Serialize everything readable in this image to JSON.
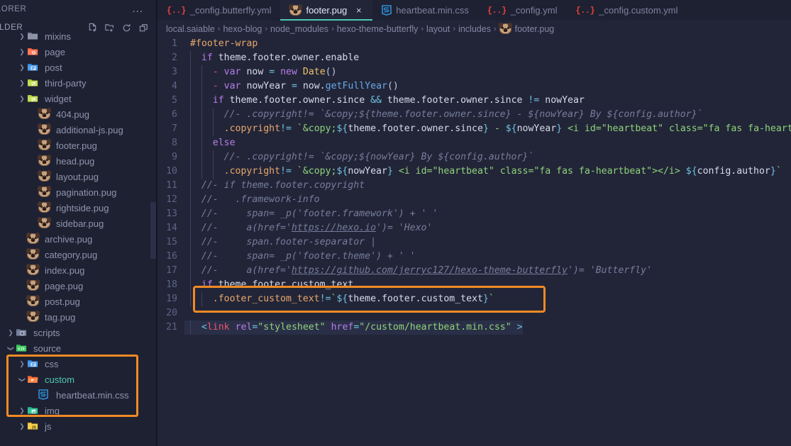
{
  "sidebar": {
    "explorer_label": "EXPLORER",
    "folder_label": "FOLDER",
    "more_actions": "...",
    "toolbar": [
      {
        "name": "new-file-icon",
        "label": "New File"
      },
      {
        "name": "new-folder-icon",
        "label": "New Folder"
      },
      {
        "name": "refresh-icon",
        "label": "Refresh Explorer"
      },
      {
        "name": "collapse-all-icon",
        "label": "Collapse Folders in Explorer"
      }
    ],
    "tree": [
      {
        "label": "mixins",
        "indent": 1,
        "chevron": "collapsed",
        "icon": "folder-grey",
        "color": "#8f95ad"
      },
      {
        "label": "page",
        "indent": 1,
        "chevron": "collapsed",
        "icon": "folder-orange",
        "color": "#8f95ad"
      },
      {
        "label": "post",
        "indent": 1,
        "chevron": "collapsed",
        "icon": "folder-blue",
        "color": "#8f95ad"
      },
      {
        "label": "third-party",
        "indent": 1,
        "chevron": "collapsed",
        "icon": "folder-lime",
        "color": "#8f95ad"
      },
      {
        "label": "widget",
        "indent": 1,
        "chevron": "collapsed",
        "icon": "folder-lime",
        "color": "#8f95ad"
      },
      {
        "label": "404.pug",
        "indent": 2,
        "chevron": "none",
        "icon": "pug-file",
        "color": "#8f95ad"
      },
      {
        "label": "additional-js.pug",
        "indent": 2,
        "chevron": "none",
        "icon": "pug-file",
        "color": "#8f95ad"
      },
      {
        "label": "footer.pug",
        "indent": 2,
        "chevron": "none",
        "icon": "pug-file",
        "color": "#8f95ad"
      },
      {
        "label": "head.pug",
        "indent": 2,
        "chevron": "none",
        "icon": "pug-file",
        "color": "#8f95ad"
      },
      {
        "label": "layout.pug",
        "indent": 2,
        "chevron": "none",
        "icon": "pug-file",
        "color": "#8f95ad"
      },
      {
        "label": "pagination.pug",
        "indent": 2,
        "chevron": "none",
        "icon": "pug-file",
        "color": "#8f95ad"
      },
      {
        "label": "rightside.pug",
        "indent": 2,
        "chevron": "none",
        "icon": "pug-file",
        "color": "#8f95ad"
      },
      {
        "label": "sidebar.pug",
        "indent": 2,
        "chevron": "none",
        "icon": "pug-file",
        "color": "#8f95ad"
      },
      {
        "label": "archive.pug",
        "indent": 1,
        "chevron": "none",
        "icon": "pug-file",
        "color": "#8f95ad"
      },
      {
        "label": "category.pug",
        "indent": 1,
        "chevron": "none",
        "icon": "pug-file",
        "color": "#8f95ad"
      },
      {
        "label": "index.pug",
        "indent": 1,
        "chevron": "none",
        "icon": "pug-file",
        "color": "#8f95ad"
      },
      {
        "label": "page.pug",
        "indent": 1,
        "chevron": "none",
        "icon": "pug-file",
        "color": "#8f95ad"
      },
      {
        "label": "post.pug",
        "indent": 1,
        "chevron": "none",
        "icon": "pug-file",
        "color": "#8f95ad"
      },
      {
        "label": "tag.pug",
        "indent": 1,
        "chevron": "none",
        "icon": "pug-file",
        "color": "#8f95ad"
      },
      {
        "label": "scripts",
        "indent": 0,
        "chevron": "collapsed",
        "icon": "folder-script",
        "color": "#8f95ad"
      },
      {
        "label": "source",
        "indent": 0,
        "chevron": "expanded",
        "icon": "folder-source",
        "color": "#8f95ad"
      },
      {
        "label": "css",
        "indent": 1,
        "chevron": "collapsed",
        "icon": "folder-blue",
        "color": "#8f95ad"
      },
      {
        "label": "custom",
        "indent": 1,
        "chevron": "expanded",
        "icon": "folder-open-orange",
        "color": "#4ec9b0"
      },
      {
        "label": "heartbeat.min.css",
        "indent": 2,
        "chevron": "none",
        "icon": "css-file",
        "color": "#8f95ad"
      },
      {
        "label": "img",
        "indent": 1,
        "chevron": "collapsed",
        "icon": "folder-teal",
        "color": "#8f95ad"
      },
      {
        "label": "js",
        "indent": 1,
        "chevron": "collapsed",
        "icon": "folder-yellow",
        "color": "#8f95ad"
      }
    ],
    "highlight_color": "#f08a24"
  },
  "tabs": [
    {
      "label": "_config.butterfly.yml",
      "icon": "yml-icon",
      "active": false,
      "closable": false
    },
    {
      "label": "footer.pug",
      "icon": "pug-icon",
      "active": true,
      "closable": true,
      "close_label": "×"
    },
    {
      "label": "heartbeat.min.css",
      "icon": "css-icon",
      "active": false,
      "closable": false
    },
    {
      "label": "_config.yml",
      "icon": "yml-icon",
      "active": false,
      "closable": false
    },
    {
      "label": "_config.custom.yml",
      "icon": "yml-icon",
      "active": false,
      "closable": false
    }
  ],
  "breadcrumb": {
    "separator": "›",
    "items": [
      {
        "label": "local.saiable",
        "icon": null
      },
      {
        "label": "hexo-blog",
        "icon": null
      },
      {
        "label": "node_modules",
        "icon": null
      },
      {
        "label": "hexo-theme-butterfly",
        "icon": null
      },
      {
        "label": "layout",
        "icon": null
      },
      {
        "label": "includes",
        "icon": null
      },
      {
        "label": "footer.pug",
        "icon": "pug-icon"
      }
    ]
  },
  "editor": {
    "active_file": "footer.pug",
    "highlight_line": 21,
    "highlight_color": "#f08a24",
    "lines": [
      {
        "n": 1,
        "tokens": [
          {
            "t": "#footer-wrap",
            "c": "t-sel"
          }
        ],
        "indent": 0
      },
      {
        "n": 2,
        "tokens": [
          {
            "t": "  ",
            "c": "t-plain"
          },
          {
            "t": "if",
            "c": "t-kw"
          },
          {
            "t": " theme.footer.owner.enable",
            "c": "t-plain"
          }
        ],
        "indent": 1
      },
      {
        "n": 3,
        "tokens": [
          {
            "t": "    ",
            "c": "t-plain"
          },
          {
            "t": "-",
            "c": "t-dash"
          },
          {
            "t": " ",
            "c": "t-plain"
          },
          {
            "t": "var",
            "c": "t-kw"
          },
          {
            "t": " now ",
            "c": "t-plain"
          },
          {
            "t": "=",
            "c": "t-op"
          },
          {
            "t": " ",
            "c": "t-plain"
          },
          {
            "t": "new",
            "c": "t-kw"
          },
          {
            "t": " ",
            "c": "t-plain"
          },
          {
            "t": "Date",
            "c": "t-cls"
          },
          {
            "t": "()",
            "c": "t-punc"
          }
        ],
        "indent": 2
      },
      {
        "n": 4,
        "tokens": [
          {
            "t": "    ",
            "c": "t-plain"
          },
          {
            "t": "-",
            "c": "t-dash"
          },
          {
            "t": " ",
            "c": "t-plain"
          },
          {
            "t": "var",
            "c": "t-kw"
          },
          {
            "t": " nowYear ",
            "c": "t-plain"
          },
          {
            "t": "=",
            "c": "t-op"
          },
          {
            "t": " now.",
            "c": "t-plain"
          },
          {
            "t": "getFullYear",
            "c": "t-fn"
          },
          {
            "t": "()",
            "c": "t-punc"
          }
        ],
        "indent": 2
      },
      {
        "n": 5,
        "tokens": [
          {
            "t": "    ",
            "c": "t-plain"
          },
          {
            "t": "if",
            "c": "t-kw"
          },
          {
            "t": " theme.footer.owner.since ",
            "c": "t-plain"
          },
          {
            "t": "&&",
            "c": "t-op"
          },
          {
            "t": " theme.footer.owner.since ",
            "c": "t-plain"
          },
          {
            "t": "!=",
            "c": "t-op"
          },
          {
            "t": " nowYear",
            "c": "t-plain"
          }
        ],
        "indent": 2
      },
      {
        "n": 6,
        "tokens": [
          {
            "t": "      //- .copyright!= `&copy;${theme.footer.owner.since} - ${nowYear} By ${config.author}`",
            "c": "t-cmt"
          }
        ],
        "indent": 3
      },
      {
        "n": 7,
        "tokens": [
          {
            "t": "      ",
            "c": "t-plain"
          },
          {
            "t": ".copyright",
            "c": "t-sel"
          },
          {
            "t": "!=",
            "c": "t-op"
          },
          {
            "t": " ",
            "c": "t-plain"
          },
          {
            "t": "`",
            "c": "t-str"
          },
          {
            "t": "&copy;",
            "c": "t-str"
          },
          {
            "t": "${",
            "c": "t-intp"
          },
          {
            "t": "theme.footer.owner.since",
            "c": "t-plain"
          },
          {
            "t": "}",
            "c": "t-intp"
          },
          {
            "t": " - ",
            "c": "t-str"
          },
          {
            "t": "${",
            "c": "t-intp"
          },
          {
            "t": "nowYear",
            "c": "t-plain"
          },
          {
            "t": "}",
            "c": "t-intp"
          },
          {
            "t": " <i id=\"heartbeat\" class=\"fa fas fa-heartbeat\">",
            "c": "t-str"
          }
        ],
        "indent": 3
      },
      {
        "n": 8,
        "tokens": [
          {
            "t": "    ",
            "c": "t-plain"
          },
          {
            "t": "else",
            "c": "t-kw"
          }
        ],
        "indent": 2
      },
      {
        "n": 9,
        "tokens": [
          {
            "t": "      //- .copyright!= `&copy;${nowYear} By ${config.author}`",
            "c": "t-cmt"
          }
        ],
        "indent": 3
      },
      {
        "n": 10,
        "tokens": [
          {
            "t": "      ",
            "c": "t-plain"
          },
          {
            "t": ".copyright",
            "c": "t-sel"
          },
          {
            "t": "!=",
            "c": "t-op"
          },
          {
            "t": " ",
            "c": "t-plain"
          },
          {
            "t": "`&copy;",
            "c": "t-str"
          },
          {
            "t": "${",
            "c": "t-intp"
          },
          {
            "t": "nowYear",
            "c": "t-plain"
          },
          {
            "t": "}",
            "c": "t-intp"
          },
          {
            "t": " <i id=\"heartbeat\" class=\"fa fas fa-heartbeat\"></i> ",
            "c": "t-str"
          },
          {
            "t": "${",
            "c": "t-intp"
          },
          {
            "t": "config.author",
            "c": "t-plain"
          },
          {
            "t": "}",
            "c": "t-intp"
          },
          {
            "t": "`",
            "c": "t-str"
          }
        ],
        "indent": 3
      },
      {
        "n": 11,
        "tokens": [
          {
            "t": "  //- if theme.footer.copyright",
            "c": "t-cmt"
          }
        ],
        "indent": 1
      },
      {
        "n": 12,
        "tokens": [
          {
            "t": "  //-   .framework-info",
            "c": "t-cmt"
          }
        ],
        "indent": 1
      },
      {
        "n": 13,
        "tokens": [
          {
            "t": "  //-     span= _p('footer.framework') + ' '",
            "c": "t-cmt"
          }
        ],
        "indent": 1
      },
      {
        "n": 14,
        "tokens": [
          {
            "t": "  //-     a(href='",
            "c": "t-cmt"
          },
          {
            "t": "https://hexo.io",
            "c": "t-cmt t-link"
          },
          {
            "t": "')= 'Hexo'",
            "c": "t-cmt"
          }
        ],
        "indent": 1
      },
      {
        "n": 15,
        "tokens": [
          {
            "t": "  //-     span.footer-separator |",
            "c": "t-cmt"
          }
        ],
        "indent": 1
      },
      {
        "n": 16,
        "tokens": [
          {
            "t": "  //-     span= _p('footer.theme') + ' '",
            "c": "t-cmt"
          }
        ],
        "indent": 1
      },
      {
        "n": 17,
        "tokens": [
          {
            "t": "  //-     a(href='",
            "c": "t-cmt"
          },
          {
            "t": "https://github.com/jerryc127/hexo-theme-butterfly",
            "c": "t-cmt t-link"
          },
          {
            "t": "')= 'Butterfly'",
            "c": "t-cmt"
          }
        ],
        "indent": 1
      },
      {
        "n": 18,
        "tokens": [
          {
            "t": "  ",
            "c": "t-plain"
          },
          {
            "t": "if",
            "c": "t-kw"
          },
          {
            "t": " theme.footer.custom_text",
            "c": "t-plain"
          }
        ],
        "indent": 1
      },
      {
        "n": 19,
        "tokens": [
          {
            "t": "    ",
            "c": "t-plain"
          },
          {
            "t": ".footer_custom_text",
            "c": "t-sel"
          },
          {
            "t": "!=",
            "c": "t-op"
          },
          {
            "t": "`",
            "c": "t-str"
          },
          {
            "t": "${",
            "c": "t-intp"
          },
          {
            "t": "theme.footer.custom_text",
            "c": "t-plain"
          },
          {
            "t": "}",
            "c": "t-intp"
          },
          {
            "t": "`",
            "c": "t-str"
          }
        ],
        "indent": 2
      },
      {
        "n": 20,
        "tokens": [],
        "indent": 0
      },
      {
        "n": 21,
        "tokens": [
          {
            "t": "  ",
            "c": "t-plain"
          },
          {
            "t": "<",
            "c": "t-lt"
          },
          {
            "t": "link",
            "c": "t-tag"
          },
          {
            "t": " ",
            "c": "t-plain"
          },
          {
            "t": "rel",
            "c": "t-attr"
          },
          {
            "t": "=",
            "c": "t-op"
          },
          {
            "t": "\"stylesheet\"",
            "c": "t-str"
          },
          {
            "t": " ",
            "c": "t-plain"
          },
          {
            "t": "href",
            "c": "t-attr"
          },
          {
            "t": "=",
            "c": "t-op"
          },
          {
            "t": "\"/custom/heartbeat.min.css\"",
            "c": "t-str"
          },
          {
            "t": " ",
            "c": "t-plain"
          },
          {
            "t": ">",
            "c": "t-lt"
          }
        ],
        "indent": 1,
        "highlighted": true
      }
    ]
  }
}
